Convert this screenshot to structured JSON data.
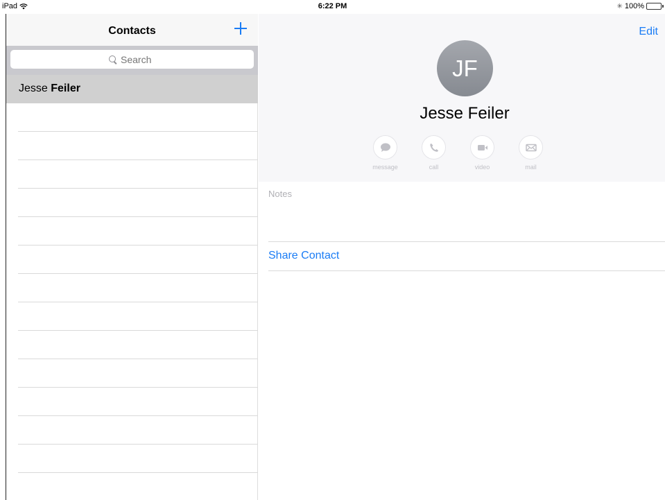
{
  "status_bar": {
    "device": "iPad",
    "time": "6:22 PM",
    "battery": "100%",
    "battery_level": 1.0
  },
  "master": {
    "title": "Contacts",
    "add_icon": "plus-icon",
    "search": {
      "placeholder": "Search"
    },
    "contacts": [
      {
        "first": "Jesse ",
        "last": "Feiler"
      }
    ]
  },
  "detail": {
    "edit_label": "Edit",
    "initials": "JF",
    "name": "Jesse Feiler",
    "actions": [
      {
        "label": "message",
        "icon": "message-icon"
      },
      {
        "label": "call",
        "icon": "phone-icon"
      },
      {
        "label": "video",
        "icon": "video-icon"
      },
      {
        "label": "mail",
        "icon": "mail-icon"
      }
    ],
    "notes_label": "Notes",
    "share_label": "Share Contact"
  },
  "colors": {
    "accent": "#1a7cf5",
    "selected_row": "#d0d0d0",
    "battery": "#4cd964"
  }
}
